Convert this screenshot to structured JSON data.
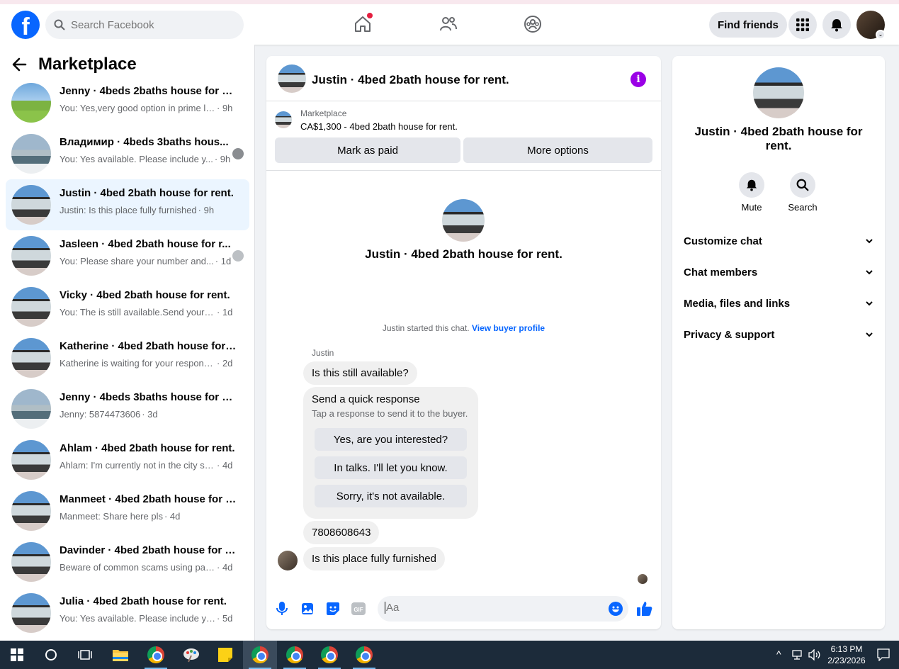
{
  "topnav": {
    "logo": "f",
    "search_placeholder": "Search Facebook",
    "find_friends": "Find friends",
    "icons": [
      "home-icon",
      "friends-icon",
      "groups-icon",
      "menu-grid-icon",
      "notifications-bell-icon",
      "profile-avatar"
    ]
  },
  "sidebar": {
    "title": "Marketplace",
    "conversations": [
      {
        "title": "Jenny · 4beds 2baths house for rent.",
        "preview": "You: Yes,very good option in prime lo...",
        "time": "· 9h"
      },
      {
        "title": "Владимир · 4beds 3baths hous...",
        "preview": "You: Yes available. Please include y...",
        "time": "· 9h"
      },
      {
        "title": "Justin · 4bed 2bath house for rent.",
        "preview": "Justin: Is this place fully furnished",
        "time": "· 9h"
      },
      {
        "title": "Jasleen · 4bed 2bath house for r...",
        "preview": "You: Please share your number and...",
        "time": "· 1d"
      },
      {
        "title": "Vicky · 4bed 2bath house for rent.",
        "preview": "You: The is still available.Send your m...",
        "time": "· 1d"
      },
      {
        "title": "Katherine · 4bed 2bath house for r...",
        "preview": "Katherine is waiting for your response.",
        "time": "· 2d"
      },
      {
        "title": "Jenny · 4beds 3baths house for rent.",
        "preview": "Jenny: 5874473606",
        "time": "· 3d"
      },
      {
        "title": "Ahlam · 4bed 2bath house for rent.",
        "preview": "Ahlam: I'm currently not in the city se...",
        "time": "· 4d"
      },
      {
        "title": "Manmeet · 4bed 2bath house for r...",
        "preview": "Manmeet: Share here pls",
        "time": "· 4d"
      },
      {
        "title": "Davinder · 4bed 2bath house for r...",
        "preview": "Beware of common scams using pay...",
        "time": "· 4d"
      },
      {
        "title": "Julia · 4bed 2bath house for rent.",
        "preview": "You: Yes available. Please include your...",
        "time": "· 5d"
      }
    ]
  },
  "chat": {
    "header_title": "Justin · 4bed 2bath house for rent.",
    "listing_source": "Marketplace",
    "listing_price": "CA$1,300 - 4bed 2bath house for rent.",
    "mark_paid": "Mark as paid",
    "more_options": "More options",
    "intro_title": "Justin · 4bed 2bath house for rent.",
    "started_text": "Justin started this chat.",
    "buyer_profile_link": "View buyer profile",
    "sender_name": "Justin",
    "messages": [
      "Is this still available?",
      "7808608643",
      "Is this place fully furnished"
    ],
    "quick_response": {
      "title": "Send a quick response",
      "subtitle": "Tap a response to send it to the buyer.",
      "options": [
        "Yes, are you interested?",
        "In talks. I'll let you know.",
        "Sorry, it's not available."
      ]
    },
    "composer_placeholder": "Aa"
  },
  "info_panel": {
    "title": "Justin · 4bed 2bath house for rent.",
    "mute": "Mute",
    "search": "Search",
    "rows": [
      "Customize chat",
      "Chat members",
      "Media, files and links",
      "Privacy & support"
    ]
  },
  "taskbar": {
    "time": "6:13 PM",
    "date": "2/23/2026"
  },
  "colors": {
    "brand_blue": "#0866ff",
    "active_conv_bg": "#ebf5ff",
    "info_purple": "#9a00e6",
    "notification_red": "#e41e3f"
  }
}
